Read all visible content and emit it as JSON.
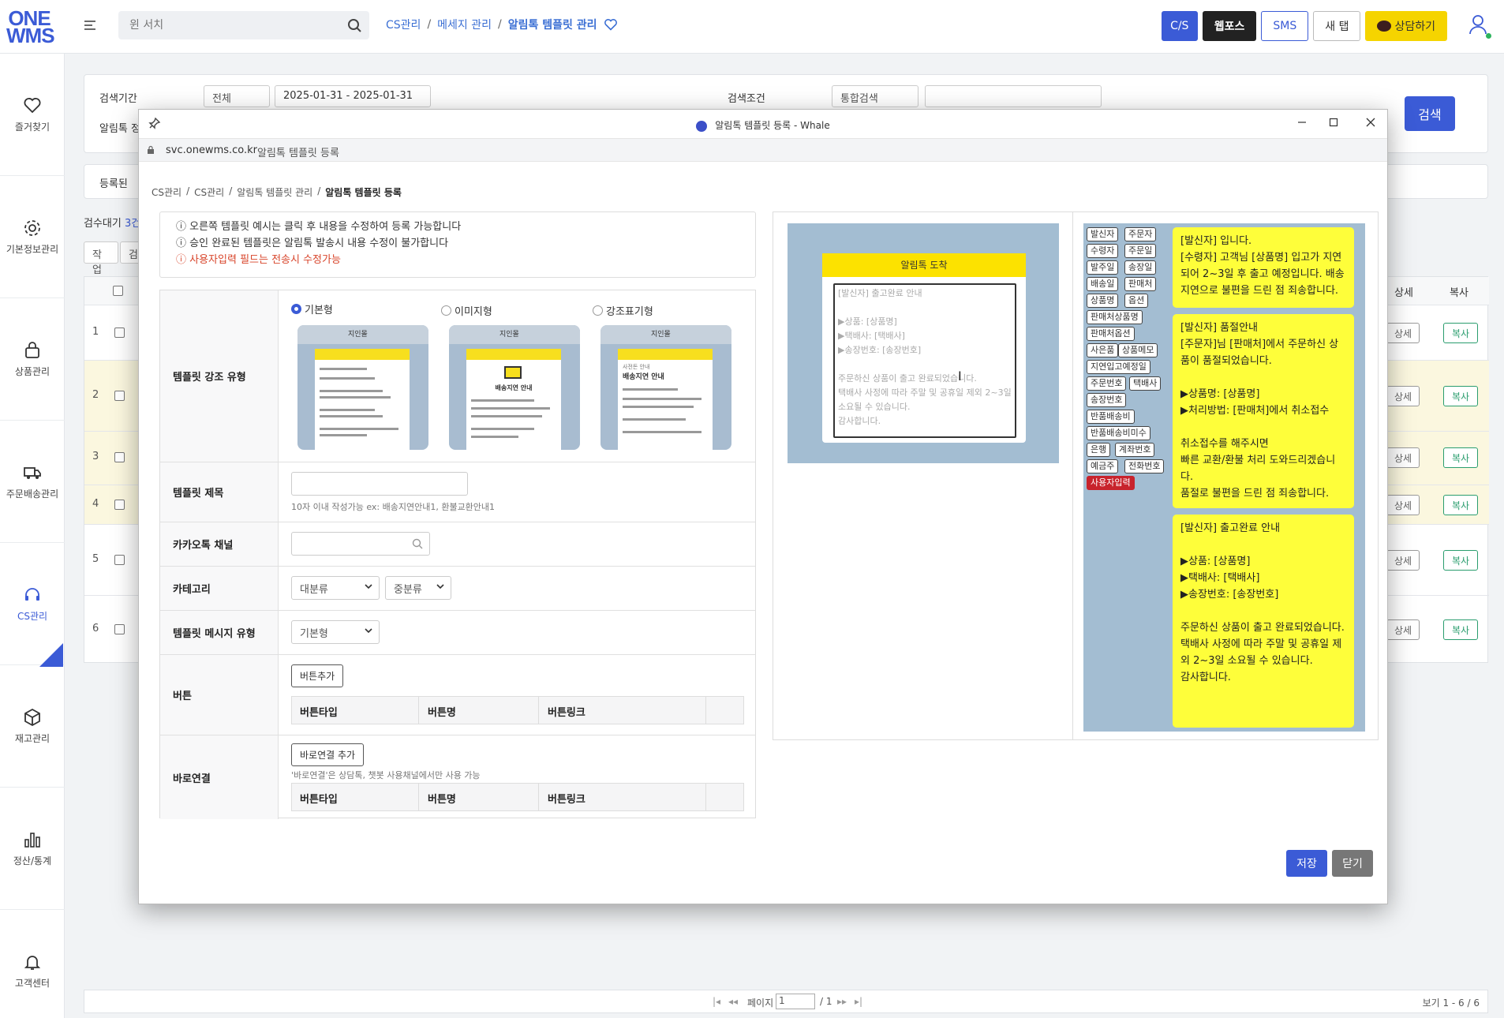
{
  "app": {
    "logo_line1": "ONE",
    "logo_line2": "WMS"
  },
  "search": {
    "placeholder": "윈 서치"
  },
  "breadcrumb": {
    "items": [
      "CS관리",
      "메세지 관리",
      "알림톡 템플릿 관리"
    ],
    "sep": "/"
  },
  "topbar": {
    "cs": "C/S",
    "webforce": "웹포스",
    "sms": "SMS",
    "newtab": "새 탭",
    "consult": "상담하기"
  },
  "sidebar": {
    "items": [
      "즐거찾기",
      "기본정보관리",
      "상품관리",
      "주문배송관리",
      "CS관리",
      "재고관리",
      "정산/통계",
      "고객센터"
    ]
  },
  "filter": {
    "period_label": "검색기간",
    "period_select": "전체",
    "date_range": "2025-01-31 - 2025-01-31",
    "cond_label": "검색조건",
    "cond_select": "통합검색",
    "alimtalk_label": "알림톡 정",
    "search_btn": "검색",
    "reg_label": "등록된",
    "count_label": "검수대기",
    "count_val": "3건",
    "tab1": "작업",
    "tab2": "검"
  },
  "table": {
    "col_detail": "상세",
    "col_copy": "복사",
    "rows": [
      "1",
      "2",
      "3",
      "4",
      "5",
      "6"
    ],
    "detail_btn": "상세",
    "copy_btn": "복사"
  },
  "pager": {
    "page_label": "페이지",
    "page_val": "1",
    "total": "/ 1",
    "view": "보기 1 - 6 / 6"
  },
  "modal": {
    "title": "알림톡 템플릿 등록 - Whale",
    "url": "svc.onewms.co.kr",
    "url_title": "알림톡 템플릿 등록",
    "crumbs": [
      "CS관리",
      "CS관리",
      "알림톡 템플릿 관리"
    ],
    "crumb_cur": "알림톡 템플릿 등록",
    "notice1": "오른쪽 템플릿 예시는 클릭 후 내용을 수정하여 등록 가능합니다",
    "notice2": "승인 완료된 템플릿은 알림톡 발송시 내용 수정이 불가합니다",
    "notice3": "사용자입력 필드는 전송시 수정가능",
    "row_emphasis": "템플릿 강조 유형",
    "radio1": "기본형",
    "radio2": "이미지형",
    "radio3": "강조표기형",
    "phone_title": "지인몰",
    "phone_card2": "배송지연 안내",
    "phone_card3a": "사전돈 안내",
    "phone_card3b": "배송지연 안내",
    "row_title": "템플릿 제목",
    "title_hint": "10자 이내 작성가능 ex: 배송지연안내1, 환불교환안내1",
    "row_channel": "카카오톡 채널",
    "row_category": "카테고리",
    "cat1": "대분류",
    "cat2": "중분류",
    "row_msgtype": "템플릿 메시지 유형",
    "msgtype": "기본형",
    "row_button": "버튼",
    "btn_add": "버튼추가",
    "col_type": "버튼타입",
    "col_name": "버튼명",
    "col_link": "버튼링크",
    "row_shortcut": "바로연결",
    "shortcut_add": "바로연결 추가",
    "shortcut_hint": "'바로연결'은 상담톡, 챗봇 사용채널에서만 사용 가능",
    "preview_head": "알림톡 도착",
    "preview_text": "[발신자] 출고완료 안내\n\n▶상품: [상품명]\n▶택배사: [택배사]\n▶송장번호: [송장번호]\n\n주문하신 상품이 출고 완료되었습니다.\n택배사 사정에 따라 주말 및 공휴일 제외 2~3일\n소요될 수 있습니다.\n감사합니다.",
    "tags": [
      "발신자",
      "주문자",
      "수령자",
      "주문일",
      "발주일",
      "송장일",
      "배송일",
      "판매처",
      "상품명",
      "옵션",
      "판매처상품명",
      "판매처옵션",
      "사은품",
      "상품메모",
      "지연입고예정일",
      "주문번호",
      "택배사",
      "송장번호",
      "반품배송비",
      "반품배송비미수",
      "은행",
      "계좌번호",
      "예금주",
      "전화번호",
      "사용자입력"
    ],
    "bubble1": "[발신자] 입니다.\n[수령자] 고객님 [상품명] 입고가 지연되어 2~3일 후 출고 예정입니다. 배송지연으로 불편을 드린 점 죄송합니다.",
    "bubble2": "[발신자] 품절안내\n[주문자]님 [판매처]에서 주문하신 상품이 품절되었습니다.\n\n▶상품명: [상품명]\n▶처리방법: [판매처]에서 취소접수\n\n취소접수를 해주시면\n빠른 교환/환불 처리 도와드리겠습니다.\n품절로 불편을 드린 점 죄송합니다.",
    "bubble3": "[발신자] 출고완료 안내\n\n▶상품: [상품명]\n▶택배사: [택배사]\n▶송장번호: [송장번호]\n\n주문하신 상품이 출고 완료되었습니다.\n택배사 사정에 따라 주말 및 공휴일 제외 2~3일 소요될 수 있습니다.\n감사합니다.",
    "save": "저장",
    "close": "닫기"
  }
}
